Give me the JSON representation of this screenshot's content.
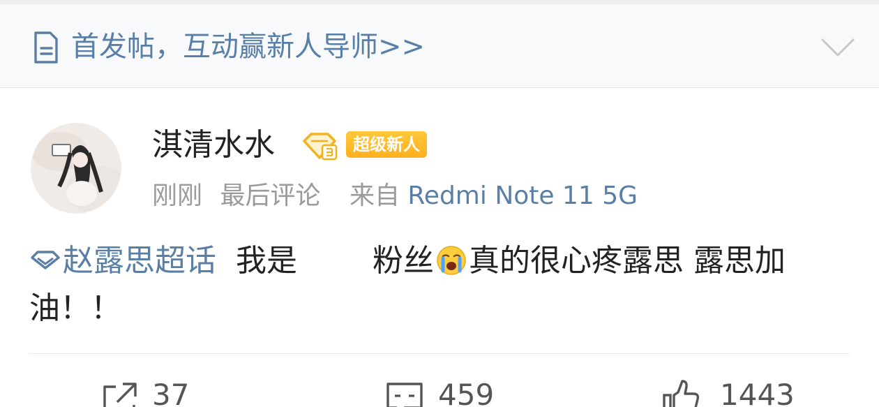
{
  "banner": {
    "text": "首发帖，互动赢新人导师>>",
    "icon": "document-icon",
    "chevron": "chevron-down-icon"
  },
  "post": {
    "username": "淇清水水",
    "vip_icon": "diamond-level-icon",
    "badge": "超级新人",
    "time": "刚刚",
    "action": "最后评论",
    "source_prefix": "来自",
    "device": "Redmi Note 11 5G",
    "topic": "赵露思超话",
    "text_part1": "我是",
    "text_part2": "粉丝",
    "emoji": "crying-emoji",
    "text_part3": "真的很心疼露思 露思加油！！"
  },
  "actions": {
    "share_count": "37",
    "comment_count": "459",
    "like_count": "1443"
  },
  "colors": {
    "link": "#5a7fa6",
    "badge": "#ffb01e",
    "meta": "#9a9a9a",
    "text": "#222222"
  }
}
